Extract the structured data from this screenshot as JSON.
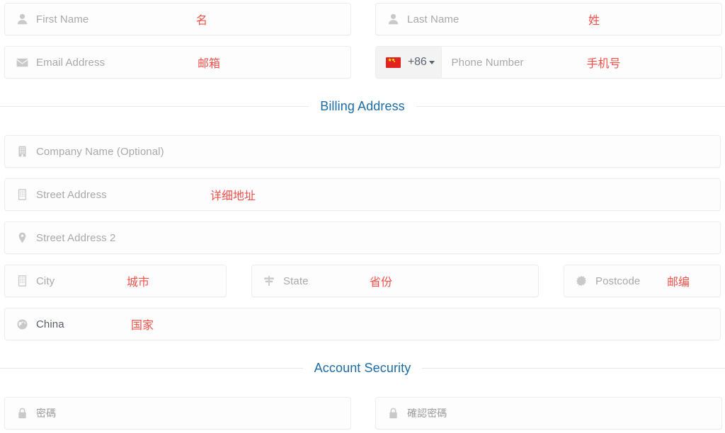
{
  "theme": {
    "accent_blue": "#1c6ca6",
    "annotation_red": "#f4504a",
    "placeholder_gray": "#a8a9ab",
    "field_border": "#eceded",
    "field_bg": "#fdfdfd",
    "icon_gray": "#c9c9c9",
    "flag_red": "#e1221e",
    "flag_yellow": "#ffe800"
  },
  "fields": {
    "first_name": {
      "placeholder": "First Name",
      "annotation": "名",
      "icon": "user-icon"
    },
    "last_name": {
      "placeholder": "Last Name",
      "annotation": "姓",
      "icon": "user-icon"
    },
    "email": {
      "placeholder": "Email Address",
      "annotation": "邮箱",
      "icon": "envelope-icon"
    },
    "phone": {
      "placeholder": "Phone Number",
      "annotation": "手机号",
      "dial_code": "+86",
      "flag_country": "China",
      "icon": "flag-icon"
    },
    "company": {
      "placeholder": "Company Name (Optional)",
      "annotation": "",
      "icon": "building-icon"
    },
    "street_address": {
      "placeholder": "Street Address",
      "annotation": "详细地址",
      "icon": "building-icon"
    },
    "street_address_2": {
      "placeholder": "Street Address 2",
      "annotation": "",
      "icon": "map-pin-icon"
    },
    "city": {
      "placeholder": "City",
      "annotation": "城市",
      "icon": "building-icon"
    },
    "state": {
      "placeholder": "State",
      "annotation": "省份",
      "icon": "signpost-icon"
    },
    "postcode": {
      "placeholder": "Postcode",
      "annotation": "邮编",
      "icon": "stamp-icon"
    },
    "country": {
      "value": "China",
      "annotation": "国家",
      "icon": "globe-icon"
    },
    "password": {
      "placeholder": "密碼",
      "annotation": "",
      "icon": "lock-icon"
    },
    "confirm_password": {
      "placeholder": "確認密碼",
      "annotation": "",
      "icon": "lock-icon"
    }
  },
  "sections": {
    "billing_address": "Billing Address",
    "account_security": "Account Security"
  }
}
